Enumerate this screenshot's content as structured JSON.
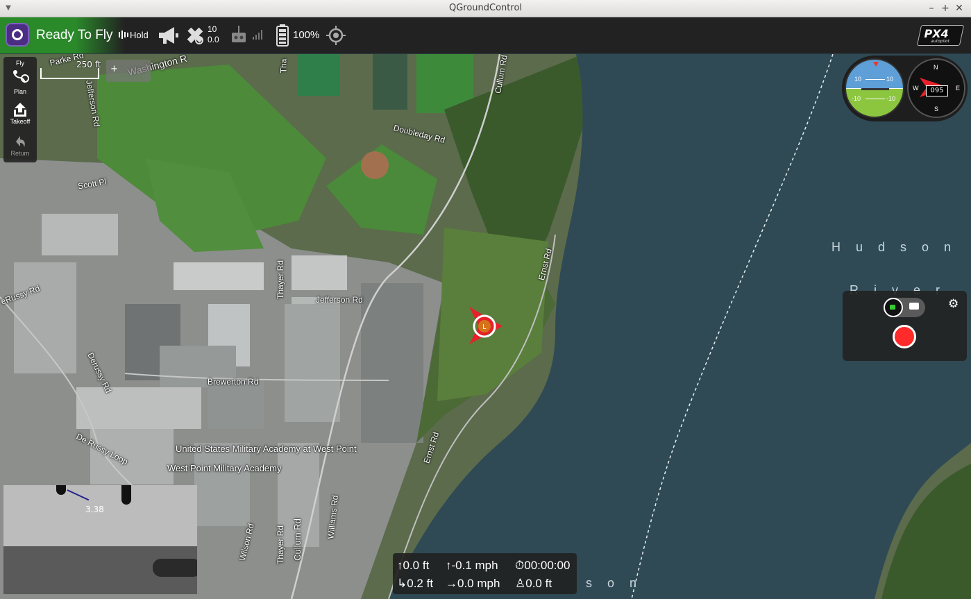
{
  "window": {
    "title": "QGroundControl"
  },
  "toolbar": {
    "status": "Ready To Fly",
    "flight_mode": "Hold",
    "gps_sat_count": "10",
    "gps_hdop": "0.0",
    "battery": "100%",
    "brand": "PX4",
    "brand_sub": "autopilot"
  },
  "toolstrip": {
    "items": [
      {
        "label": "Fly",
        "icon": "fly-icon"
      },
      {
        "label": "Plan",
        "icon": "plan-icon"
      },
      {
        "label": "Takeoff",
        "icon": "takeoff-icon"
      },
      {
        "label": "Return",
        "icon": "return-icon"
      }
    ]
  },
  "map": {
    "scale": "250 ft",
    "zoom_plus": "+",
    "labels": {
      "parke_rd": "Parke Rd",
      "washington": "Washington R",
      "jefferson_rd_1": "Jefferson Rd",
      "thayer_1": "Tha",
      "cullum_rd_1": "Cullum Rd",
      "doubleday_rd": "Doubleday Rd",
      "scott_pl": "Scott Pl",
      "derussy_rd_1": "eRussy Rd",
      "jefferson_rd_2": "Jefferson Rd",
      "thayer_rd_2": "Thayer Rd",
      "ernst_rd_1": "Ernst Rd",
      "derussy_rd_2": "Derussy Rd",
      "brewerton_rd": "Brewerton Rd",
      "de_russy_loop": "De Russy Loop",
      "usma": "United States Military Academy at West Point",
      "wp_academy": "West Point Military Academy",
      "ernst_rd_2": "Ernst Rd",
      "williams_rd": "Williams Rd",
      "wilson_rd": "Wilson Rd",
      "thayer_rd_3": "Thayer Rd",
      "cullum_rd_2": "Cullum Rd",
      "hudson": "Hudson",
      "river": "River",
      "son": "son"
    },
    "vehicle_marker": "L"
  },
  "instruments": {
    "pitch_labels": [
      "10",
      "10",
      "-10",
      "-10"
    ],
    "heading": "095",
    "compass": {
      "n": "N",
      "s": "S",
      "e": "E",
      "w": "W"
    }
  },
  "camera": {
    "mode": "video"
  },
  "pip": {
    "value": "3.38"
  },
  "telemetry": {
    "altitude": "0.0 ft",
    "vertical_speed": "-0.1 mph",
    "flight_time": "00:00:00",
    "distance": "0.2 ft",
    "ground_speed": "0.0 mph",
    "home_distance": "0.0 ft"
  },
  "colors": {
    "toolbar_bg": "#222222",
    "ready_green": "#2a8a2a",
    "record": "#ff2a2a",
    "water": "#2f4a55"
  }
}
